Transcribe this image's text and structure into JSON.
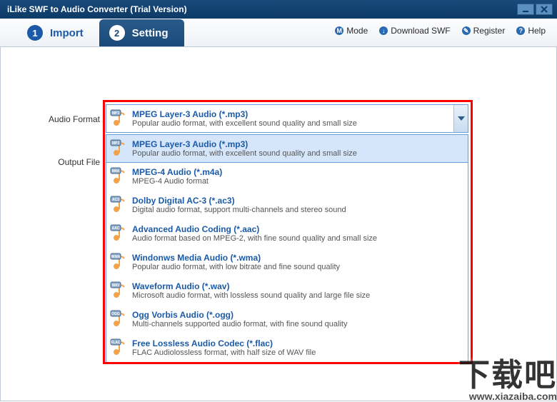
{
  "window": {
    "title": "iLike SWF to Audio Converter (Trial Version)"
  },
  "tabs": [
    {
      "num": "1",
      "label": "Import"
    },
    {
      "num": "2",
      "label": "Setting"
    }
  ],
  "toplinks": {
    "mode": {
      "glyph": "M",
      "label": "Mode"
    },
    "download": {
      "glyph": "↓",
      "label": "Download SWF"
    },
    "register": {
      "glyph": "✎",
      "label": "Register"
    },
    "help": {
      "glyph": "?",
      "label": "Help"
    }
  },
  "labels": {
    "audio_format": "Audio Format",
    "output_file": "Output File"
  },
  "selected": {
    "badge": "MP3",
    "name": "MPEG Layer-3 Audio (*.mp3)",
    "desc": "Popular audio format, with excellent sound quality and small size"
  },
  "formats": [
    {
      "badge": "MP3",
      "name": "MPEG Layer-3 Audio (*.mp3)",
      "desc": "Popular audio format, with excellent sound quality and small size"
    },
    {
      "badge": "M4A",
      "name": "MPEG-4 Audio (*.m4a)",
      "desc": "MPEG-4 Audio format"
    },
    {
      "badge": "AC3",
      "name": "Dolby Digital AC-3 (*.ac3)",
      "desc": "Digital audio format, support multi-channels and stereo sound"
    },
    {
      "badge": "AAC",
      "name": "Advanced Audio Coding (*.aac)",
      "desc": "Audio format based on MPEG-2, with fine sound quality and small size"
    },
    {
      "badge": "WMA",
      "name": "Windonws Media Audio (*.wma)",
      "desc": "Popular audio format, with low bitrate and fine sound quality"
    },
    {
      "badge": "WAV",
      "name": "Waveform Audio (*.wav)",
      "desc": "Microsoft audio format, with lossless sound quality and large file size"
    },
    {
      "badge": "OGG",
      "name": "Ogg Vorbis Audio (*.ogg)",
      "desc": "Multi-channels supported audio format, with fine sound quality"
    },
    {
      "badge": "FLAC",
      "name": "Free Lossless Audio Codec (*.flac)",
      "desc": "FLAC Audiolossless format, with half size of WAV file"
    }
  ],
  "watermark": {
    "main": "下载吧",
    "sub": "www.xiazaiba.com"
  }
}
